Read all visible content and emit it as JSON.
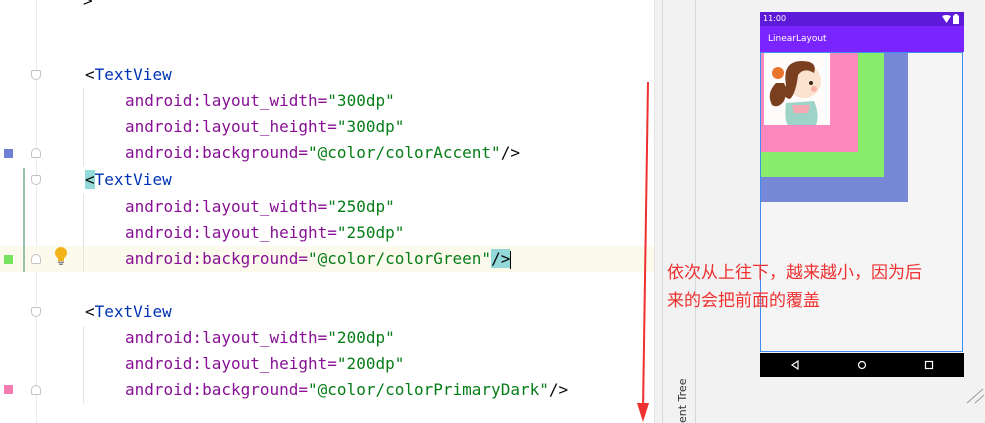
{
  "editor": {
    "lines": [
      {
        "kind": "tag",
        "lt": "<",
        "tag": "TextView"
      },
      {
        "kind": "attr",
        "attr": "android:layout_width=",
        "val": "\"300dp\""
      },
      {
        "kind": "attr",
        "attr": "android:layout_height=",
        "val": "\"300dp\""
      },
      {
        "kind": "attr",
        "attr": "android:background=",
        "val": "\"@color/colorAccent\"",
        "end": "/>"
      },
      {
        "kind": "tag",
        "lt": "<",
        "tag": "TextView"
      },
      {
        "kind": "attr",
        "attr": "android:layout_width=",
        "val": "\"250dp\""
      },
      {
        "kind": "attr",
        "attr": "android:layout_height=",
        "val": "\"250dp\""
      },
      {
        "kind": "attr",
        "attr": "android:background=",
        "val": "\"@color/colorGreen\"",
        "end": "/>"
      },
      {
        "kind": "tag",
        "lt": "<",
        "tag": "TextView"
      },
      {
        "kind": "attr",
        "attr": "android:layout_width=",
        "val": "\"200dp\""
      },
      {
        "kind": "attr",
        "attr": "android:layout_height=",
        "val": "\"200dp\""
      },
      {
        "kind": "attr",
        "attr": "android:background=",
        "val": "\"@color/colorPrimaryDark\"",
        "end": "/>"
      }
    ],
    "gutter_colors": {
      "accent": "#6e7fd4",
      "green": "#77e25c",
      "primary_dark": "#f57bb3"
    },
    "bulb_icon": "lightbulb-icon"
  },
  "side_panel": {
    "label": "ent Tree"
  },
  "preview": {
    "status_time": "11:00",
    "app_title": "LinearLayout",
    "colors": {
      "status_bar": "#5d1bd9",
      "app_bar": "#7a24ff",
      "rect_300": "#7788d6",
      "rect_250": "#88ed6b",
      "rect_200": "#fd88be"
    },
    "nav_icons": [
      "back-icon",
      "home-icon",
      "recents-icon"
    ]
  },
  "annotation": {
    "line1": "依次从上往下，越来越小，因为后",
    "line2": "来的会把前面的覆盖",
    "color": "#ee3030"
  }
}
